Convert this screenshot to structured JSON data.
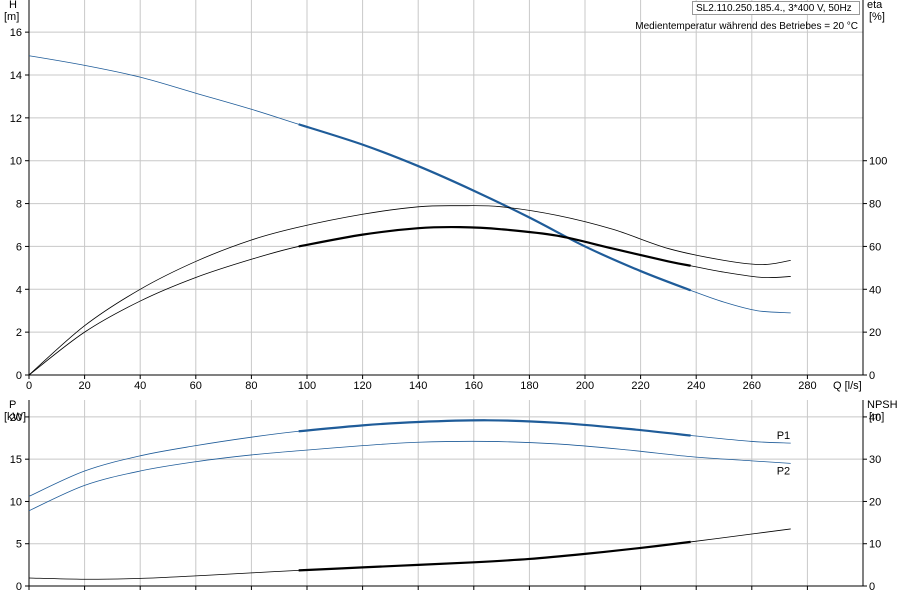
{
  "header": {
    "title": "SL2.110.250.185.4., 3*400 V, 50Hz",
    "note": "Medientemperatur während des Betriebes = 20 °C"
  },
  "colors": {
    "grid": "#c8c8c8",
    "curve_blue": "#1f5c99",
    "curve_black": "#000000"
  },
  "chart_data": [
    {
      "type": "line",
      "name": "upper",
      "x_label": "Q [l/s]",
      "xlim": [
        0,
        300
      ],
      "x_ticks": [
        0,
        20,
        40,
        60,
        80,
        100,
        120,
        140,
        160,
        180,
        200,
        220,
        240,
        260,
        280
      ],
      "left_axis": {
        "label": "H",
        "unit": "[m]",
        "ylim": [
          0,
          17.5
        ],
        "ticks": [
          0,
          2,
          4,
          6,
          8,
          10,
          12,
          14,
          16
        ]
      },
      "right_axis": {
        "label": "eta",
        "unit": "[%]",
        "ylim": [
          0,
          175
        ],
        "ticks": [
          0,
          20,
          40,
          60,
          80,
          100
        ]
      },
      "series": [
        {
          "id": "H",
          "axis": "left",
          "color": "blue",
          "x": [
            0,
            20,
            40,
            60,
            80,
            97,
            120,
            140,
            160,
            180,
            200,
            220,
            238,
            250,
            262,
            274
          ],
          "y": [
            14.9,
            14.45,
            13.9,
            13.15,
            12.4,
            11.7,
            10.75,
            9.75,
            8.6,
            7.35,
            6.0,
            4.85,
            3.95,
            3.4,
            3.0,
            2.9
          ],
          "bold_range": [
            97,
            238
          ]
        },
        {
          "id": "eta_upper",
          "axis": "right",
          "color": "black",
          "x": [
            0,
            20,
            40,
            60,
            80,
            97,
            120,
            140,
            155,
            170,
            190,
            210,
            230,
            250,
            264,
            274
          ],
          "y": [
            0,
            23,
            40,
            53,
            63,
            69,
            75,
            78.5,
            79,
            78.5,
            74.5,
            68,
            59,
            53.5,
            51.5,
            53.5
          ]
        },
        {
          "id": "eta",
          "axis": "right",
          "color": "black",
          "x": [
            0,
            20,
            40,
            60,
            80,
            97,
            120,
            140,
            155,
            170,
            190,
            210,
            230,
            238,
            250,
            264,
            274
          ],
          "y": [
            0,
            20,
            34.5,
            45.5,
            54,
            60,
            65.5,
            68.5,
            69,
            68,
            65,
            59,
            53,
            51,
            48,
            45.5,
            46
          ],
          "bold_range": [
            97,
            238
          ]
        }
      ]
    },
    {
      "type": "line",
      "name": "lower",
      "xlim": [
        0,
        300
      ],
      "left_axis": {
        "label": "P",
        "unit": "[kW]",
        "ylim": [
          0,
          22
        ],
        "ticks": [
          0,
          5,
          10,
          15,
          20
        ]
      },
      "right_axis": {
        "label": "NPSH",
        "unit": "[m]",
        "ylim": [
          0,
          44
        ],
        "ticks": [
          0,
          10,
          20,
          30,
          40
        ]
      },
      "series": [
        {
          "id": "P1",
          "name": "P1",
          "axis": "left",
          "color": "blue",
          "x": [
            0,
            20,
            40,
            60,
            80,
            97,
            120,
            140,
            165,
            190,
            215,
            238,
            260,
            274
          ],
          "y": [
            10.6,
            13.6,
            15.4,
            16.6,
            17.6,
            18.3,
            19.0,
            19.4,
            19.6,
            19.3,
            18.6,
            17.8,
            17.1,
            16.9
          ],
          "bold_range": [
            97,
            238
          ]
        },
        {
          "id": "P2",
          "name": "P2",
          "axis": "left",
          "color": "blue",
          "x": [
            0,
            20,
            40,
            60,
            80,
            97,
            120,
            140,
            165,
            190,
            215,
            238,
            260,
            274
          ],
          "y": [
            8.9,
            11.9,
            13.6,
            14.7,
            15.5,
            16.0,
            16.6,
            17.0,
            17.1,
            16.8,
            16.1,
            15.3,
            14.8,
            14.5
          ]
        },
        {
          "id": "NPSH",
          "axis": "right",
          "color": "black",
          "x": [
            0,
            20,
            40,
            60,
            80,
            97,
            120,
            140,
            160,
            180,
            200,
            220,
            240,
            260,
            274
          ],
          "y": [
            1.9,
            1.6,
            1.8,
            2.4,
            3.1,
            3.7,
            4.4,
            5.0,
            5.6,
            6.4,
            7.6,
            9.0,
            10.6,
            12.3,
            13.5
          ],
          "bold_range": [
            97,
            238
          ]
        }
      ]
    }
  ]
}
